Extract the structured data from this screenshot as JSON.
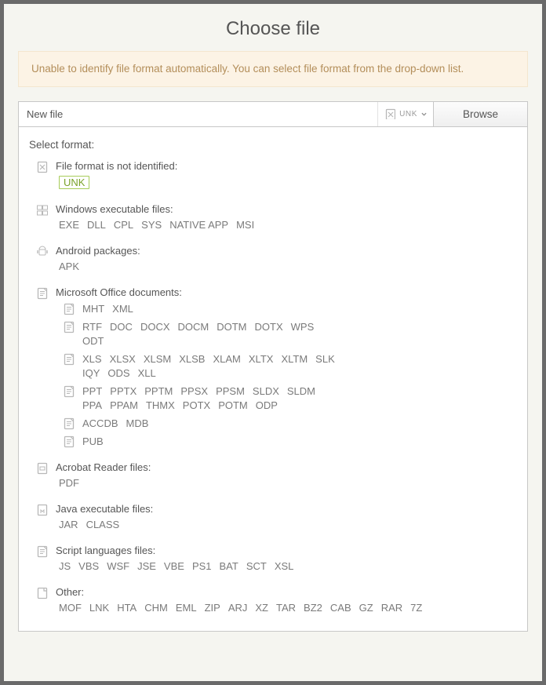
{
  "title": "Choose file",
  "alert": "Unable to identify file format automatically. You can select file format from the drop-down list.",
  "file_input_value": "New file",
  "format_dropdown": "UNK",
  "browse_label": "Browse",
  "select_format_label": "Select format:",
  "groups": {
    "unidentified": {
      "title": "File format is not identified:",
      "formats": [
        "UNK"
      ],
      "selected": "UNK"
    },
    "windows": {
      "title": "Windows executable files:",
      "formats": [
        "EXE",
        "DLL",
        "CPL",
        "SYS",
        "NATIVE APP",
        "MSI"
      ]
    },
    "android": {
      "title": "Android packages:",
      "formats": [
        "APK"
      ]
    },
    "office": {
      "title": "Microsoft Office documents:",
      "sub": [
        {
          "formats": [
            "MHT",
            "XML"
          ]
        },
        {
          "formats": [
            "RTF",
            "DOC",
            "DOCX",
            "DOCM",
            "DOTM",
            "DOTX",
            "WPS",
            "ODT"
          ]
        },
        {
          "formats": [
            "XLS",
            "XLSX",
            "XLSM",
            "XLSB",
            "XLAM",
            "XLTX",
            "XLTM",
            "SLK",
            "IQY",
            "ODS",
            "XLL"
          ]
        },
        {
          "formats": [
            "PPT",
            "PPTX",
            "PPTM",
            "PPSX",
            "PPSM",
            "SLDX",
            "SLDM",
            "PPA",
            "PPAM",
            "THMX",
            "POTX",
            "POTM",
            "ODP"
          ]
        },
        {
          "formats": [
            "ACCDB",
            "MDB"
          ]
        },
        {
          "formats": [
            "PUB"
          ]
        }
      ]
    },
    "acrobat": {
      "title": "Acrobat Reader files:",
      "formats": [
        "PDF"
      ]
    },
    "java": {
      "title": "Java executable files:",
      "formats": [
        "JAR",
        "CLASS"
      ]
    },
    "script": {
      "title": "Script languages files:",
      "formats": [
        "JS",
        "VBS",
        "WSF",
        "JSE",
        "VBE",
        "PS1",
        "BAT",
        "SCT",
        "XSL"
      ]
    },
    "other": {
      "title": "Other:",
      "formats": [
        "MOF",
        "LNK",
        "HTA",
        "CHM",
        "EML",
        "ZIP",
        "ARJ",
        "XZ",
        "TAR",
        "BZ2",
        "CAB",
        "GZ",
        "RAR",
        "7Z"
      ]
    }
  }
}
